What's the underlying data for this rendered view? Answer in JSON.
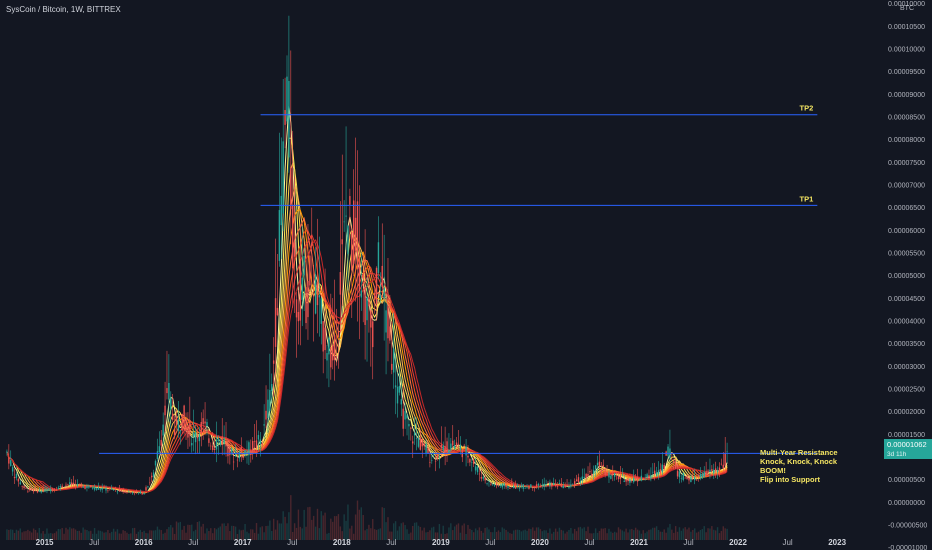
{
  "title": "SysCoin / Bitcoin, 1W, BITTREX",
  "currency_label": "BTC",
  "colors": {
    "background": "#131722",
    "axis_text": "#b2b5be",
    "up_candle": "#26a69a",
    "down_candle": "#ef5350",
    "level_line": "#2962ff",
    "annotation": "#f5e663",
    "price_badge": "#26a69a"
  },
  "price_badge": {
    "value": "0.00001062",
    "sub": "3d 11h"
  },
  "chart_data": {
    "type": "candlestick",
    "y_ticks": [
      "0.00010000",
      "0.00010500",
      "0.00010000",
      "0.00009500",
      "0.00009000",
      "0.00008500",
      "0.00008000",
      "0.00007500",
      "0.00007000",
      "0.00006500",
      "0.00006000",
      "0.00005500",
      "0.00005000",
      "0.00004500",
      "0.00004000",
      "0.00003500",
      "0.00003000",
      "0.00002500",
      "0.00002000",
      "0.00001500",
      "0.00000500",
      "0.00000000",
      "-0.00000500",
      "-0.00001000"
    ],
    "y_tick_values": [
      0.00011,
      0.000105,
      0.0001,
      9.5e-05,
      9e-05,
      8.5e-05,
      8e-05,
      7.5e-05,
      7e-05,
      6.5e-05,
      6e-05,
      5.5e-05,
      5e-05,
      4.5e-05,
      4e-05,
      3.5e-05,
      3e-05,
      2.5e-05,
      2e-05,
      1.5e-05,
      5e-06,
      0.0,
      -5e-06,
      -1e-05
    ],
    "ylim": [
      -1.05e-05,
      0.0001108
    ],
    "x_ticks": [
      {
        "label": "2015",
        "t": 2015.0,
        "major": true
      },
      {
        "label": "Jul",
        "t": 2015.5,
        "major": false
      },
      {
        "label": "2016",
        "t": 2016.0,
        "major": true
      },
      {
        "label": "Jul",
        "t": 2016.5,
        "major": false
      },
      {
        "label": "2017",
        "t": 2017.0,
        "major": true
      },
      {
        "label": "Jul",
        "t": 2017.5,
        "major": false
      },
      {
        "label": "2018",
        "t": 2018.0,
        "major": true
      },
      {
        "label": "Jul",
        "t": 2018.5,
        "major": false
      },
      {
        "label": "2019",
        "t": 2019.0,
        "major": true
      },
      {
        "label": "Jul",
        "t": 2019.5,
        "major": false
      },
      {
        "label": "2020",
        "t": 2020.0,
        "major": true
      },
      {
        "label": "Jul",
        "t": 2020.5,
        "major": false
      },
      {
        "label": "2021",
        "t": 2021.0,
        "major": true
      },
      {
        "label": "Jul",
        "t": 2021.5,
        "major": false
      },
      {
        "label": "2022",
        "t": 2022.0,
        "major": true
      },
      {
        "label": "Jul",
        "t": 2022.5,
        "major": false
      },
      {
        "label": "2023",
        "t": 2023.0,
        "major": true
      }
    ],
    "xlim": [
      2014.55,
      2023.15
    ],
    "price_series": [
      [
        2014.62,
        1.1e-05
      ],
      [
        2014.7,
        6e-06
      ],
      [
        2014.8,
        3e-06
      ],
      [
        2014.95,
        2.5e-06
      ],
      [
        2015.1,
        3e-06
      ],
      [
        2015.25,
        4e-06
      ],
      [
        2015.4,
        3.5e-06
      ],
      [
        2015.6,
        3e-06
      ],
      [
        2015.8,
        2.5e-06
      ],
      [
        2016.0,
        2e-06
      ],
      [
        2016.1,
        6e-06
      ],
      [
        2016.18,
        1.5e-05
      ],
      [
        2016.25,
        2.4e-05
      ],
      [
        2016.32,
        1.6e-05
      ],
      [
        2016.4,
        1.9e-05
      ],
      [
        2016.5,
        1.4e-05
      ],
      [
        2016.6,
        1.7e-05
      ],
      [
        2016.7,
        1.3e-05
      ],
      [
        2016.8,
        1.4e-05
      ],
      [
        2016.9,
        1e-05
      ],
      [
        2017.0,
        1.1e-05
      ],
      [
        2017.1,
        1.2e-05
      ],
      [
        2017.2,
        1.4e-05
      ],
      [
        2017.3,
        2.6e-05
      ],
      [
        2017.35,
        4.8e-05
      ],
      [
        2017.4,
        7e-05
      ],
      [
        2017.45,
        9.2e-05
      ],
      [
        2017.5,
        6e-05
      ],
      [
        2017.55,
        4.2e-05
      ],
      [
        2017.6,
        5e-05
      ],
      [
        2017.65,
        4.5e-05
      ],
      [
        2017.7,
        5.2e-05
      ],
      [
        2017.78,
        4e-05
      ],
      [
        2017.85,
        3.6e-05
      ],
      [
        2017.92,
        3e-05
      ],
      [
        2018.0,
        5.2e-05
      ],
      [
        2018.05,
        6.4e-05
      ],
      [
        2018.1,
        5.8e-05
      ],
      [
        2018.15,
        6e-05
      ],
      [
        2018.2,
        5e-05
      ],
      [
        2018.25,
        4.2e-05
      ],
      [
        2018.3,
        3.8e-05
      ],
      [
        2018.38,
        5.2e-05
      ],
      [
        2018.45,
        4e-05
      ],
      [
        2018.52,
        3.2e-05
      ],
      [
        2018.6,
        2e-05
      ],
      [
        2018.7,
        1.5e-05
      ],
      [
        2018.8,
        1.3e-05
      ],
      [
        2018.9,
        1e-05
      ],
      [
        2019.0,
        1.1e-05
      ],
      [
        2019.1,
        1.3e-05
      ],
      [
        2019.2,
        1.2e-05
      ],
      [
        2019.3,
        1e-05
      ],
      [
        2019.4,
        6e-06
      ],
      [
        2019.5,
        4e-06
      ],
      [
        2019.7,
        3.5e-06
      ],
      [
        2019.9,
        3.5e-06
      ],
      [
        2020.1,
        4e-06
      ],
      [
        2020.3,
        3.5e-06
      ],
      [
        2020.4,
        5e-06
      ],
      [
        2020.5,
        6e-06
      ],
      [
        2020.6,
        8e-06
      ],
      [
        2020.7,
        6e-06
      ],
      [
        2020.9,
        5e-06
      ],
      [
        2021.1,
        5.5e-06
      ],
      [
        2021.25,
        8e-06
      ],
      [
        2021.3,
        1.2e-05
      ],
      [
        2021.4,
        6e-06
      ],
      [
        2021.55,
        5e-06
      ],
      [
        2021.7,
        6.5e-06
      ],
      [
        2021.82,
        7.5e-06
      ],
      [
        2021.9,
        1.06e-05
      ]
    ],
    "levels": [
      {
        "name": "TP2",
        "value": 8.55e-05,
        "t_start": 2017.18,
        "t_end": 2022.8
      },
      {
        "name": "TP1",
        "value": 6.55e-05,
        "t_start": 2017.18,
        "t_end": 2022.8
      },
      {
        "name": "",
        "value": 1.08e-05,
        "t_start": 2015.55,
        "t_end": 2022.8
      }
    ],
    "annotations": [
      "Multi-Year Resistance",
      "Knock, Knock, Knock",
      "BOOM!",
      "Flip into Support"
    ]
  }
}
